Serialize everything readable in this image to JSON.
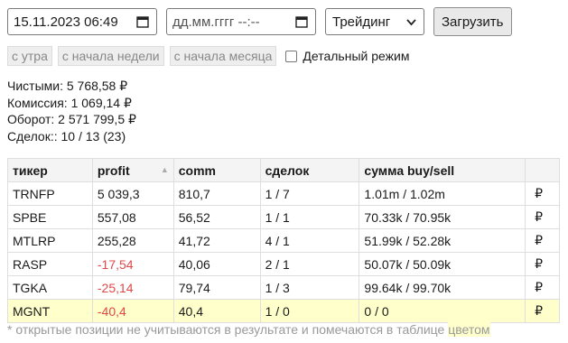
{
  "filters": {
    "date_from_value": "15.11.2023  06:49",
    "date_to_placeholder": "дд.мм.гггг  --:--",
    "mode_selected": "Трейдинг",
    "load_button": "Загрузить",
    "presets": [
      "с утра",
      "с начала недели",
      "с начала месяца"
    ],
    "detail_mode_label": "Детальный режим",
    "detail_mode_checked": false
  },
  "summary": {
    "net": "Чистыми: 5 768,58 ₽",
    "commission": "Комиссия: 1 069,14 ₽",
    "turnover": "Оборот: 2 571 799,5 ₽",
    "deals": "Сделок:: 10 / 13 (23)"
  },
  "table": {
    "headers": [
      "тикер",
      "profit",
      "comm",
      "сделок",
      "сумма buy/sell",
      ""
    ],
    "rows": [
      {
        "ticker": "TRNFP",
        "profit": "5 039,3",
        "comm": "810,7",
        "deals": "1 / 7",
        "sum": "1.01m / 1.02m",
        "cur": "₽",
        "negative": false,
        "open": false
      },
      {
        "ticker": "SPBE",
        "profit": "557,08",
        "comm": "56,52",
        "deals": "1 / 1",
        "sum": "70.33k / 70.95k",
        "cur": "₽",
        "negative": false,
        "open": false
      },
      {
        "ticker": "MTLRP",
        "profit": "255,28",
        "comm": "41,72",
        "deals": "4 / 1",
        "sum": "51.99k / 52.28k",
        "cur": "₽",
        "negative": false,
        "open": false
      },
      {
        "ticker": "RASP",
        "profit": "-17,54",
        "comm": "40,06",
        "deals": "2 / 1",
        "sum": "50.07k / 50.09k",
        "cur": "₽",
        "negative": true,
        "open": false
      },
      {
        "ticker": "TGKA",
        "profit": "-25,14",
        "comm": "79,74",
        "deals": "1 / 3",
        "sum": "99.64k / 99.70k",
        "cur": "₽",
        "negative": true,
        "open": false
      },
      {
        "ticker": "MGNT",
        "profit": "-40,4",
        "comm": "40,4",
        "deals": "1 / 0",
        "sum": "0 / 0",
        "cur": "₽",
        "negative": true,
        "open": true
      }
    ]
  },
  "footnote": {
    "text": "* открытые позиции не учитываются в результате и помечаются в таблице ",
    "highlight": "цветом"
  },
  "colors": {
    "negative": "#e04848",
    "open_position": "#ffffcc"
  }
}
